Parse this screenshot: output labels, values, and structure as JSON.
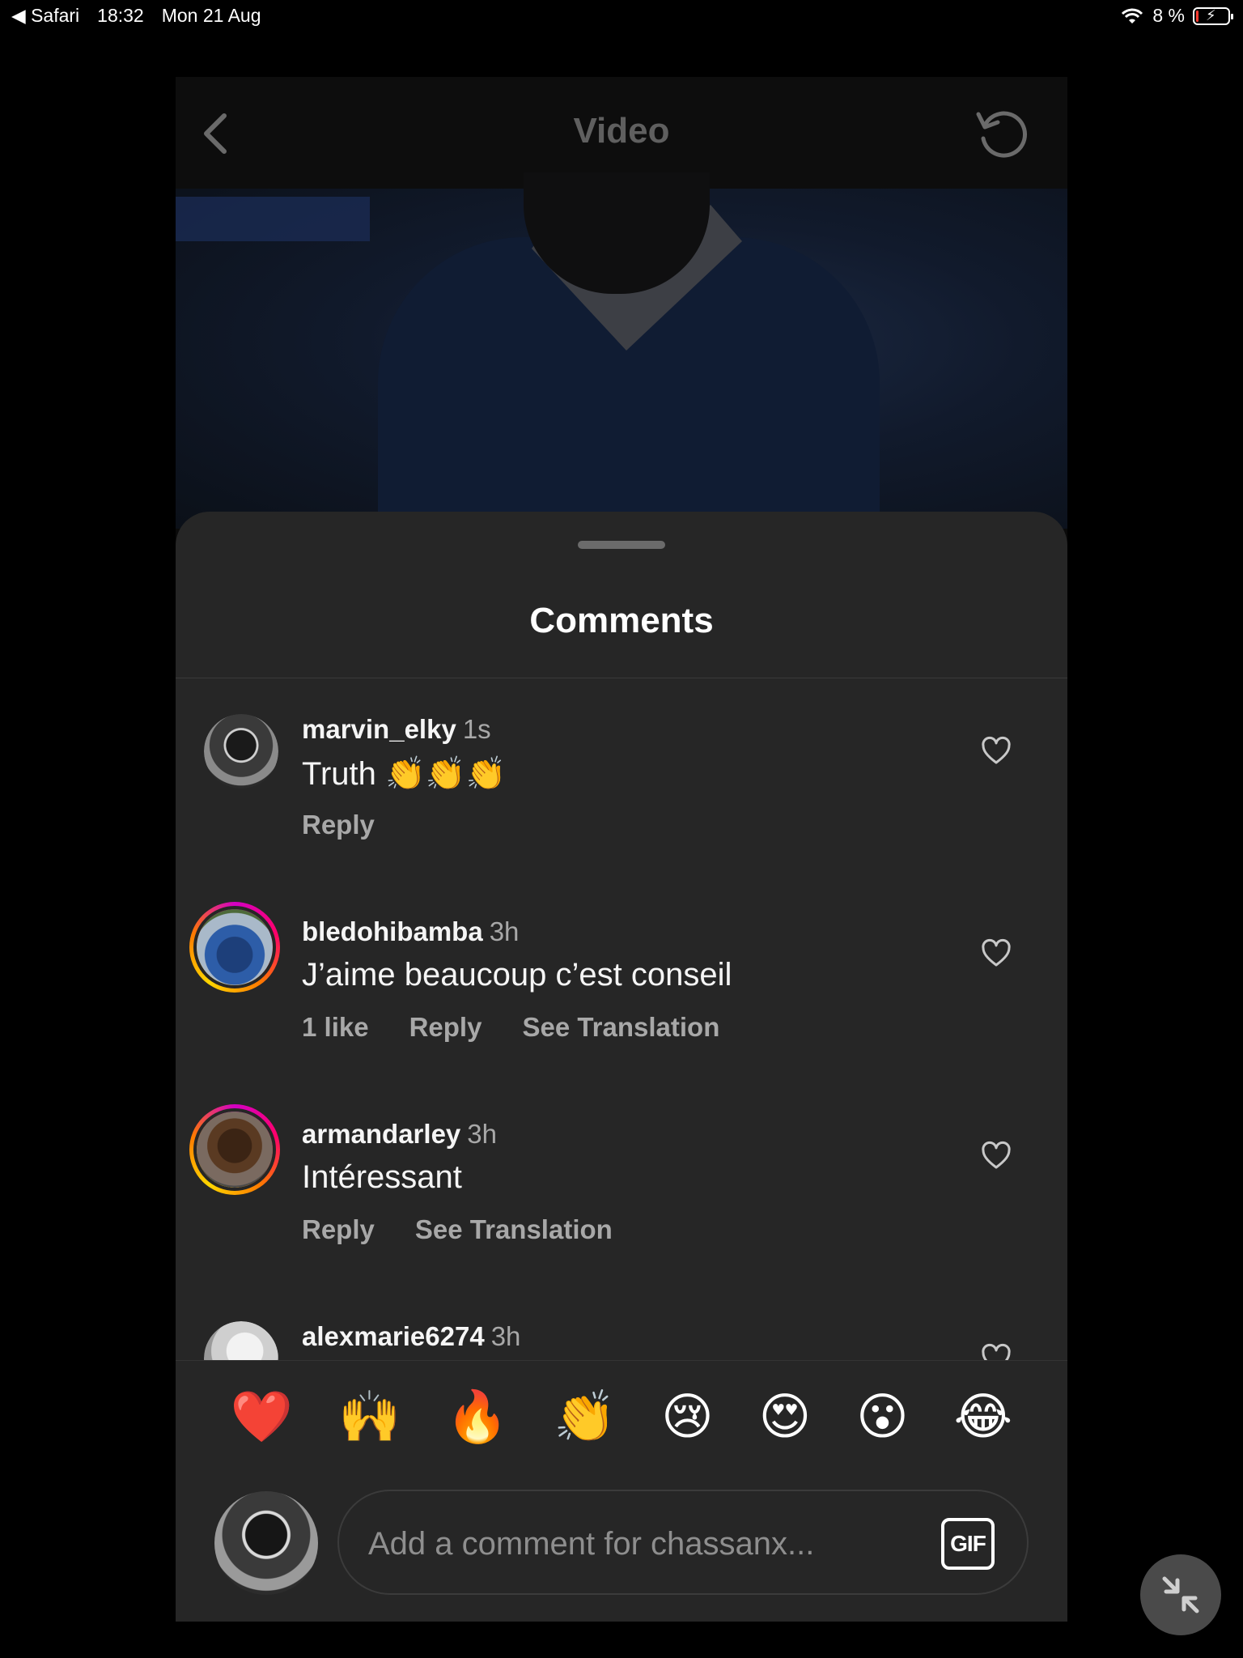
{
  "status_bar": {
    "back_app": "◀ Safari",
    "time": "18:32",
    "date": "Mon 21 Aug",
    "battery_percent": "8 %",
    "wifi_icon": "wifi-icon",
    "battery_level_fraction": 0.08
  },
  "nav": {
    "title": "Video"
  },
  "comments_sheet": {
    "title": "Comments",
    "comments": [
      {
        "user": "marvin_elky",
        "time": "1s",
        "text": "Truth 👏👏👏",
        "actions": {
          "reply": "Reply"
        }
      },
      {
        "user": "bledohibamba",
        "time": "3h",
        "text": "J’aime beaucoup c’est conseil",
        "actions": {
          "likes": "1 like",
          "reply": "Reply",
          "translate": "See Translation"
        }
      },
      {
        "user": "armandarley",
        "time": "3h",
        "text": "Intéressant",
        "actions": {
          "reply": "Reply",
          "translate": "See Translation"
        }
      },
      {
        "user": "alexmarie6274",
        "time": "3h"
      }
    ]
  },
  "emoji_bar": [
    "❤️",
    "🙌",
    "🔥",
    "👏",
    "😢",
    "😍",
    "😮",
    "😂"
  ],
  "composer": {
    "placeholder": "Add a comment for chassanx...",
    "gif_label": "GIF"
  },
  "colors": {
    "sheet_bg": "#262626",
    "story_ring": "#ff0069",
    "battery_low": "#ff3b30"
  }
}
